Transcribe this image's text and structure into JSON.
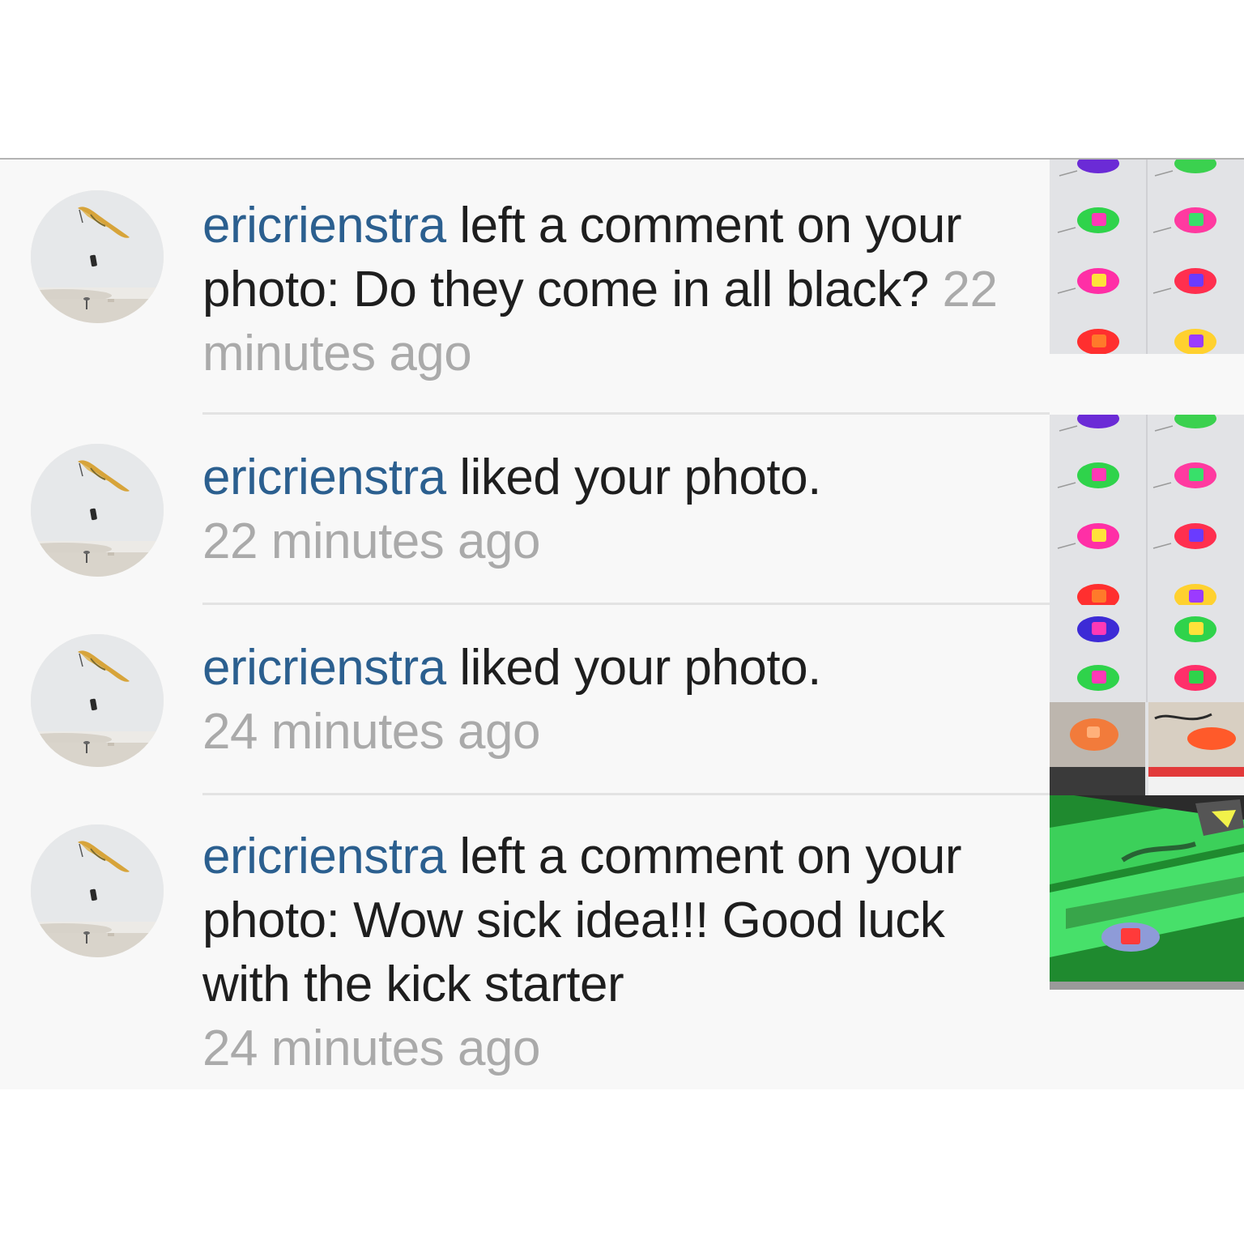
{
  "notifications": [
    {
      "username": "ericrienstra",
      "action": " left a comment on your photo: Do they come in all black? ",
      "time": "22 minutes ago",
      "avatar_icon": "kiteboarder-avatar",
      "thumbnail": "colored-clips-grid"
    },
    {
      "username": "ericrienstra",
      "action": " liked your photo.",
      "time": "22 minutes ago",
      "avatar_icon": "kiteboarder-avatar",
      "thumbnail": "colored-clips-grid"
    },
    {
      "username": "ericrienstra",
      "action": " liked your photo.",
      "time": "24 minutes ago",
      "avatar_icon": "kiteboarder-avatar",
      "thumbnail": "clips-collage"
    },
    {
      "username": "ericrienstra",
      "action": " left a comment on your photo: Wow sick idea!!! Good luck with the kick starter",
      "time": "24 minutes ago",
      "avatar_icon": "kiteboarder-avatar",
      "thumbnail": "green-board-with-clip"
    }
  ],
  "colors": {
    "username": "#2b5f8f",
    "text": "#1e1e1e",
    "timestamp": "#aaaaaa",
    "feed_background": "#f8f8f8",
    "divider": "#e3e3e3"
  }
}
